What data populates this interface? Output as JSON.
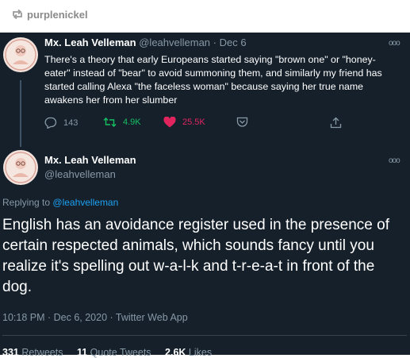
{
  "reblog": {
    "username": "purplenickel",
    "icon": "reblog-icon"
  },
  "quoted_tweet": {
    "display_name": "Mx. Leah Velleman",
    "handle": "@leahvelleman",
    "date": "Dec 6",
    "text": "There's a theory that early Europeans started saying \"brown one\" or \"honey-eater\" instead of \"bear\" to avoid summoning them, and similarly my friend has started calling Alexa \"the faceless woman\" because saying her true name awakens her from her slumber",
    "replies": "143",
    "retweets": "4.9K",
    "likes": "25.5K"
  },
  "main_tweet": {
    "display_name": "Mx. Leah Velleman",
    "handle": "@leahvelleman",
    "replying_prefix": "Replying to",
    "replying_to": "@leahvelleman",
    "text": "English has an avoidance register used in the presence of certain respected animals, which sounds fancy until you realize it's spelling out w-a-l-k and t-r-e-a-t in front of the dog.",
    "timestamp": "10:18 PM · Dec 6, 2020 · Twitter Web App",
    "retweets_count": "331",
    "retweets_label": "Retweets",
    "quote_count": "11",
    "quote_label": "Quote Tweets",
    "likes_count": "2.6K",
    "likes_label": "Likes"
  },
  "colors": {
    "background": "#15202b",
    "secondary_text": "#8899a6",
    "accent": "#1da1f2",
    "retweet": "#17bf63",
    "like": "#e0245e"
  }
}
